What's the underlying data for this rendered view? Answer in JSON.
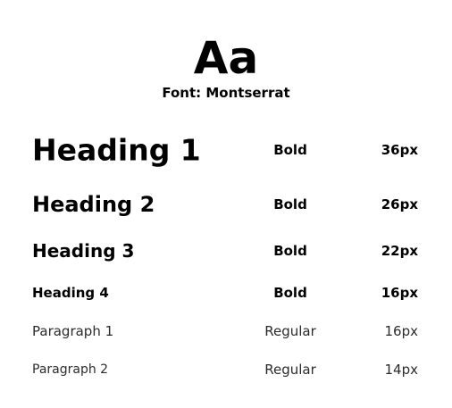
{
  "hero": {
    "specimen": "Aa",
    "font_label": "Font: Montserrat"
  },
  "rows": [
    {
      "name": "Heading 1",
      "weight": "Bold",
      "size": "36px"
    },
    {
      "name": "Heading 2",
      "weight": "Bold",
      "size": "26px"
    },
    {
      "name": "Heading 3",
      "weight": "Bold",
      "size": "22px"
    },
    {
      "name": "Heading 4",
      "weight": "Bold",
      "size": "16px"
    },
    {
      "name": "Paragraph 1",
      "weight": "Regular",
      "size": "16px"
    },
    {
      "name": "Paragraph 2",
      "weight": "Regular",
      "size": "14px"
    }
  ],
  "colors": {
    "text": "#000000",
    "regular_text": "#2b2b2b",
    "background": "#ffffff"
  }
}
